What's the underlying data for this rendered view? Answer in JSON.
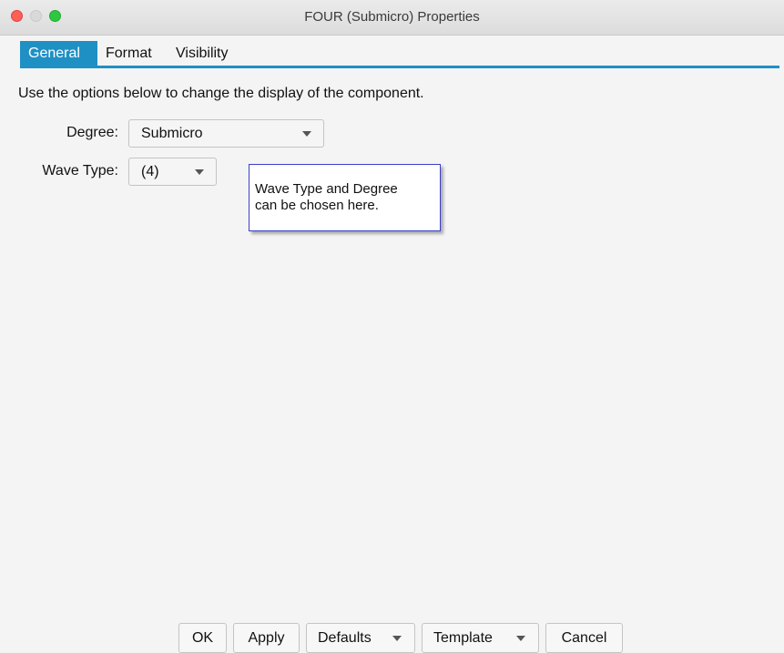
{
  "window": {
    "title": "FOUR (Submicro) Properties"
  },
  "tabs": [
    {
      "label": "General",
      "active": true
    },
    {
      "label": "Format",
      "active": false
    },
    {
      "label": "Visibility",
      "active": false
    }
  ],
  "general": {
    "intro": "Use the options below to change the display of the component.",
    "degree_label": "Degree:",
    "degree_value": "Submicro",
    "wave_type_label": "Wave Type:",
    "wave_type_value": "(4)"
  },
  "callout": {
    "line1": "Wave Type and Degree",
    "line2": "can be chosen here."
  },
  "buttons": {
    "ok": "OK",
    "apply": "Apply",
    "defaults": "Defaults",
    "template": "Template",
    "cancel": "Cancel"
  },
  "colors": {
    "accent": "#1f90c4",
    "callout_border": "#3b3fc9"
  }
}
